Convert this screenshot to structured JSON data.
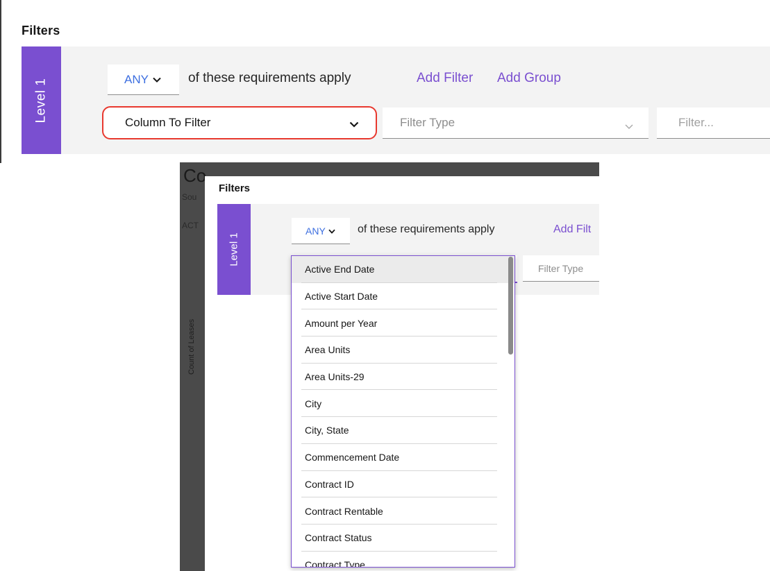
{
  "top": {
    "title": "Filters",
    "level_label": "Level 1",
    "match_mode": "ANY",
    "requirements_text": "of these requirements apply",
    "add_filter": "Add Filter",
    "add_group": "Add Group",
    "column_select": "Column To Filter",
    "filter_type_placeholder": "Filter Type",
    "filter_value_placeholder": "Filter..."
  },
  "background": {
    "chart_title": "Co",
    "chart_subtitle": "Sou",
    "chart_row": "ACT",
    "y_axis": "Count of Leases"
  },
  "bottom": {
    "title": "Filters",
    "level_label": "Level 1",
    "match_mode": "ANY",
    "requirements_text": "of these requirements apply",
    "add_filter_truncated": "Add Filt",
    "filter_type_placeholder": "Filter Type",
    "dropdown_options": [
      "Active End Date",
      "Active Start Date",
      "Amount per Year",
      "Area Units",
      "Area Units-29",
      "City",
      "City, State",
      "Commencement Date",
      "Contract ID",
      "Contract Rentable",
      "Contract Status",
      "Contract Type"
    ],
    "highlighted_option": "Active End Date"
  },
  "colors": {
    "accent_purple": "#7a4fd0",
    "link_blue": "#3d6fe0",
    "highlight_red": "#e8382e",
    "panel_gray": "#f3f3f3"
  }
}
